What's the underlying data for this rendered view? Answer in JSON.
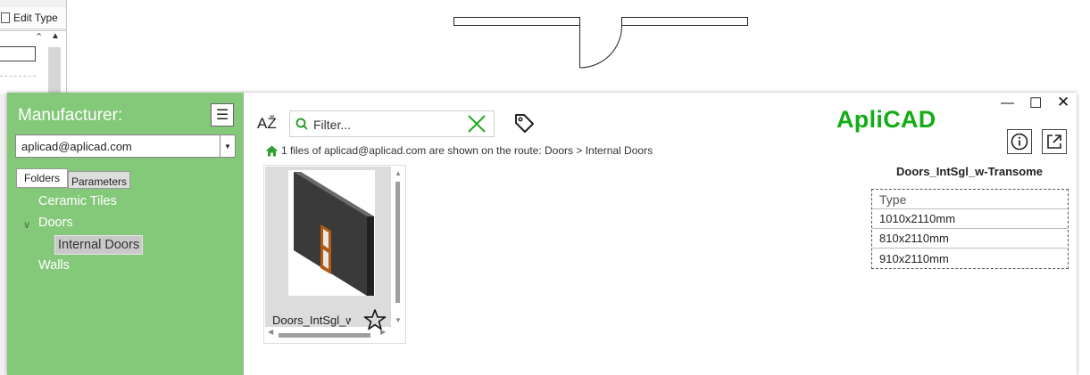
{
  "background": {
    "edit_type_label": "Edit Type"
  },
  "sidebar": {
    "title": "Manufacturer:",
    "manufacturer_selected": "aplicad@aplicad.com",
    "tabs": [
      {
        "label": "Folders",
        "active": true
      },
      {
        "label": "Parameters",
        "active": false
      }
    ],
    "tree": [
      {
        "label": "Ceramic Tiles",
        "level": 0
      },
      {
        "label": "Doors",
        "level": 0,
        "expanded": true
      },
      {
        "label": "Internal Doors",
        "level": 1,
        "selected": true
      },
      {
        "label": "Walls",
        "level": 0
      }
    ],
    "background_color": "#84c879"
  },
  "toolbar": {
    "filter_placeholder": "Filter...",
    "sort_icon": "sort-az-icon",
    "tag_icon": "tag-icon"
  },
  "route": {
    "text": "1 files of aplicad@aplicad.com are shown on the route: Doors > Internal Doors"
  },
  "brand": {
    "name": "ApliCAD",
    "color": "#14ac14"
  },
  "grid": {
    "items": [
      {
        "label": "Doors_IntSgl_w-Transome",
        "favorite": false
      }
    ]
  },
  "detail": {
    "name": "Doors_IntSgl_w-Transome",
    "type_header": "Type",
    "types": [
      "1010x2110mm",
      "810x2110mm",
      "910x2110mm"
    ]
  }
}
